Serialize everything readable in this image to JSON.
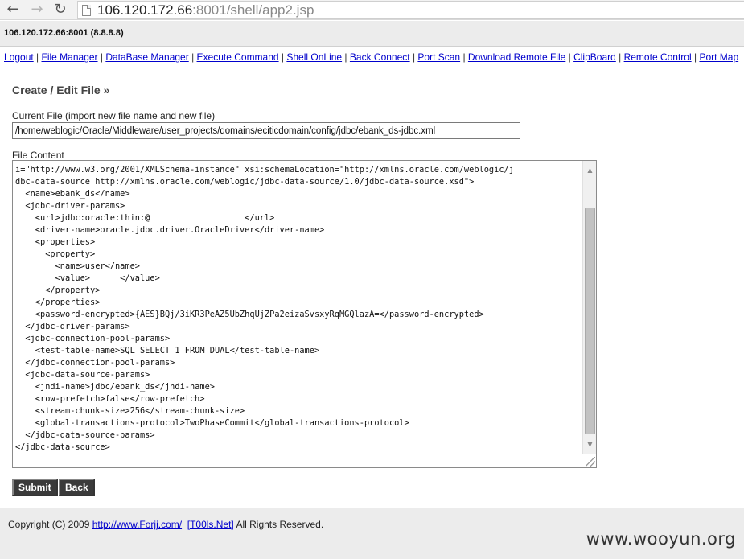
{
  "browser": {
    "back_icon": "←",
    "forward_icon": "→",
    "refresh_icon": "↻",
    "url_host": "106.120.172.66",
    "url_rest": ":8001/shell/app2.jsp"
  },
  "host_bar": {
    "text": "106.120.172.66:8001 (8.8.8.8)"
  },
  "menu": {
    "items": [
      "Logout",
      "File Manager",
      "DataBase Manager",
      "Execute Command",
      "Shell OnLine",
      "Back Connect",
      "Port Scan",
      "Download Remote File",
      "ClipBoard",
      "Remote Control",
      "Port Map"
    ],
    "separator": " | "
  },
  "editor": {
    "title": "Create / Edit File »",
    "current_file_label": "Current File (import new file name and new file)",
    "current_file_value": "/home/weblogic/Oracle/Middleware/user_projects/domains/eciticdomain/config/jdbc/ebank_ds-jdbc.xml",
    "content_label": "File Content",
    "content_lines": [
      "i=\"http://www.w3.org/2001/XMLSchema-instance\" xsi:schemaLocation=\"http://xmlns.oracle.com/weblogic/j",
      "dbc-data-source http://xmlns.oracle.com/weblogic/jdbc-data-source/1.0/jdbc-data-source.xsd\">",
      "  <name>ebank_ds</name>",
      "  <jdbc-driver-params>",
      "    <url>jdbc:oracle:thin:@                   </url>",
      "    <driver-name>oracle.jdbc.driver.OracleDriver</driver-name>",
      "    <properties>",
      "      <property>",
      "        <name>user</name>",
      "        <value>      </value>",
      "      </property>",
      "    </properties>",
      "    <password-encrypted>{AES}BQj/3iKR3PeAZ5UbZhqUjZPa2eizaSvsxyRqMGQlazA=</password-encrypted>",
      "  </jdbc-driver-params>",
      "  <jdbc-connection-pool-params>",
      "    <test-table-name>SQL SELECT 1 FROM DUAL</test-table-name>",
      "  </jdbc-connection-pool-params>",
      "  <jdbc-data-source-params>",
      "    <jndi-name>jdbc/ebank_ds</jndi-name>",
      "    <row-prefetch>false</row-prefetch>",
      "    <stream-chunk-size>256</stream-chunk-size>",
      "    <global-transactions-protocol>TwoPhaseCommit</global-transactions-protocol>",
      "  </jdbc-data-source-params>",
      "</jdbc-data-source>"
    ],
    "submit_label": "Submit",
    "back_label": "Back"
  },
  "footer": {
    "copyright": "Copyright (C) 2009 ",
    "link1": "http://www.Forjj.com/",
    "link2": "[T00ls.Net]",
    "rights": " All Rights Reserved."
  },
  "watermark": "www.wooyun.org"
}
